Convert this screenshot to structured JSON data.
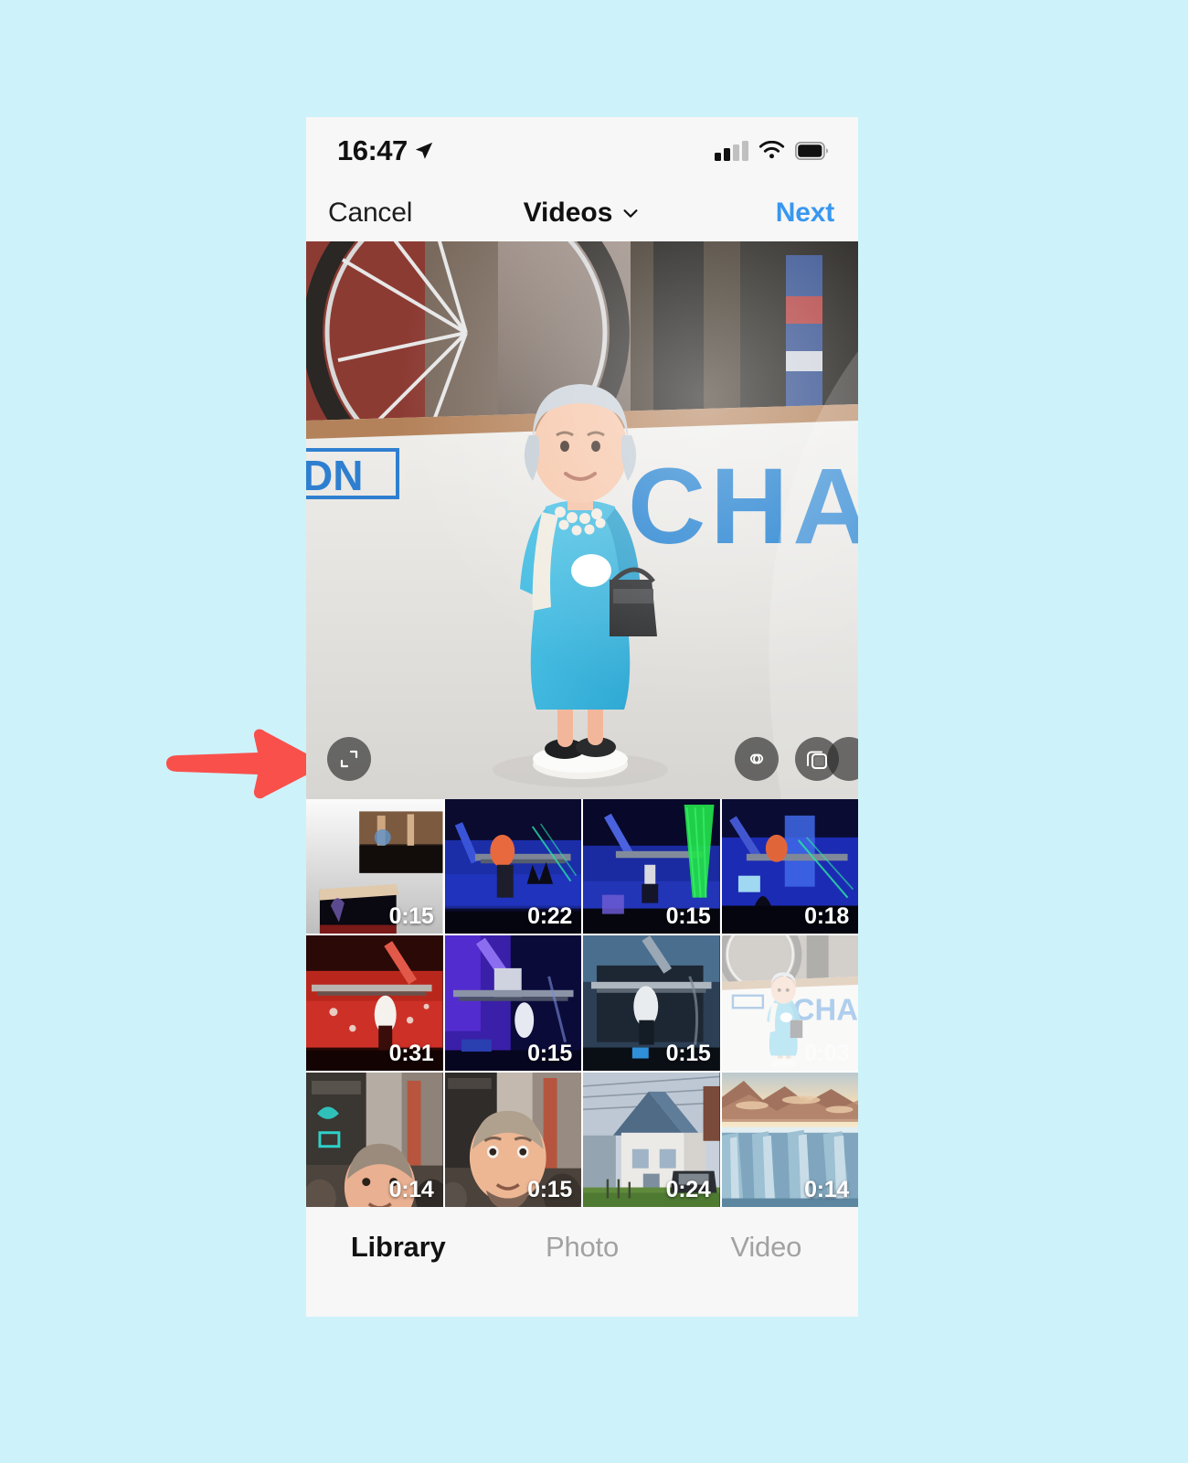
{
  "page": {
    "background_color": "#cdf2fa",
    "annotation": {
      "type": "arrow",
      "color": "#f9504c",
      "points_to": "expand-button"
    }
  },
  "status_bar": {
    "time": "16:47",
    "location_icon": "location-arrow-icon",
    "signal_icon": "cellular-signal-icon",
    "signal_bars_filled": 2,
    "signal_bars_total": 4,
    "wifi_icon": "wifi-icon",
    "battery_icon": "battery-icon",
    "battery_level": 90
  },
  "nav_bar": {
    "cancel_label": "Cancel",
    "title": "Videos",
    "title_chevron": "chevron-down-icon",
    "next_label": "Next",
    "next_color": "#3897f0"
  },
  "preview": {
    "alt": "Queen Elizabeth figurine in a bicycle shop window",
    "overlay_buttons": [
      {
        "name": "expand-button",
        "icon": "expand-corners-icon",
        "label": "Expand"
      },
      {
        "name": "boomerang-button",
        "icon": "infinity-icon",
        "label": "Boomerang"
      },
      {
        "name": "select-multiple-button",
        "icon": "layers-icon",
        "label": "Select Multiple"
      }
    ]
  },
  "grid": {
    "items": [
      {
        "id": "t1",
        "duration": "0:15",
        "art": "loading-concert",
        "selected": false
      },
      {
        "id": "t2",
        "duration": "0:22",
        "art": "concert-blue-crowd",
        "selected": false
      },
      {
        "id": "t3",
        "duration": "0:15",
        "art": "concert-green-laser",
        "selected": false
      },
      {
        "id": "t4",
        "duration": "0:18",
        "art": "concert-blue-stage",
        "selected": false
      },
      {
        "id": "t5",
        "duration": "0:31",
        "art": "concert-red",
        "selected": false
      },
      {
        "id": "t6",
        "duration": "0:15",
        "art": "concert-purple",
        "selected": false
      },
      {
        "id": "t7",
        "duration": "0:15",
        "art": "concert-steel-blue",
        "selected": false
      },
      {
        "id": "t8",
        "duration": "0:03",
        "art": "queen-figurine",
        "selected": true
      },
      {
        "id": "t9",
        "duration": "0:14",
        "art": "street-selfie-a",
        "selected": false
      },
      {
        "id": "t10",
        "duration": "0:15",
        "art": "street-selfie-b",
        "selected": false
      },
      {
        "id": "t11",
        "duration": "0:24",
        "art": "house-blue-roof",
        "selected": false
      },
      {
        "id": "t12",
        "duration": "0:14",
        "art": "glacier",
        "selected": false
      }
    ]
  },
  "tab_bar": {
    "tabs": [
      {
        "label": "Library",
        "active": true
      },
      {
        "label": "Photo",
        "active": false
      },
      {
        "label": "Video",
        "active": false
      }
    ]
  },
  "home_indicator": {
    "name": "home-indicator"
  }
}
